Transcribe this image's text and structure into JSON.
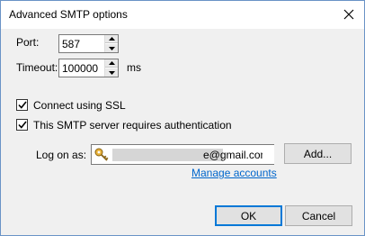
{
  "dialog": {
    "title": "Advanced SMTP options",
    "close_glyph": "✕"
  },
  "port": {
    "label": "Port:",
    "value": "587"
  },
  "timeout": {
    "label": "Timeout:",
    "value": "100000",
    "unit": "ms"
  },
  "ssl": {
    "label": "Connect using SSL",
    "checked": true
  },
  "auth": {
    "label": "This SMTP server requires authentication",
    "checked": true
  },
  "logon": {
    "label": "Log on as:",
    "account_visible": "e@gmail.com",
    "account_icon": "key-icon",
    "add_label": "Add...",
    "manage_link": "Manage accounts"
  },
  "buttons": {
    "ok": "OK",
    "cancel": "Cancel"
  },
  "colors": {
    "link": "#0066cc",
    "focus_border": "#0078d7",
    "dialog_bg": "#f0f0f0"
  }
}
